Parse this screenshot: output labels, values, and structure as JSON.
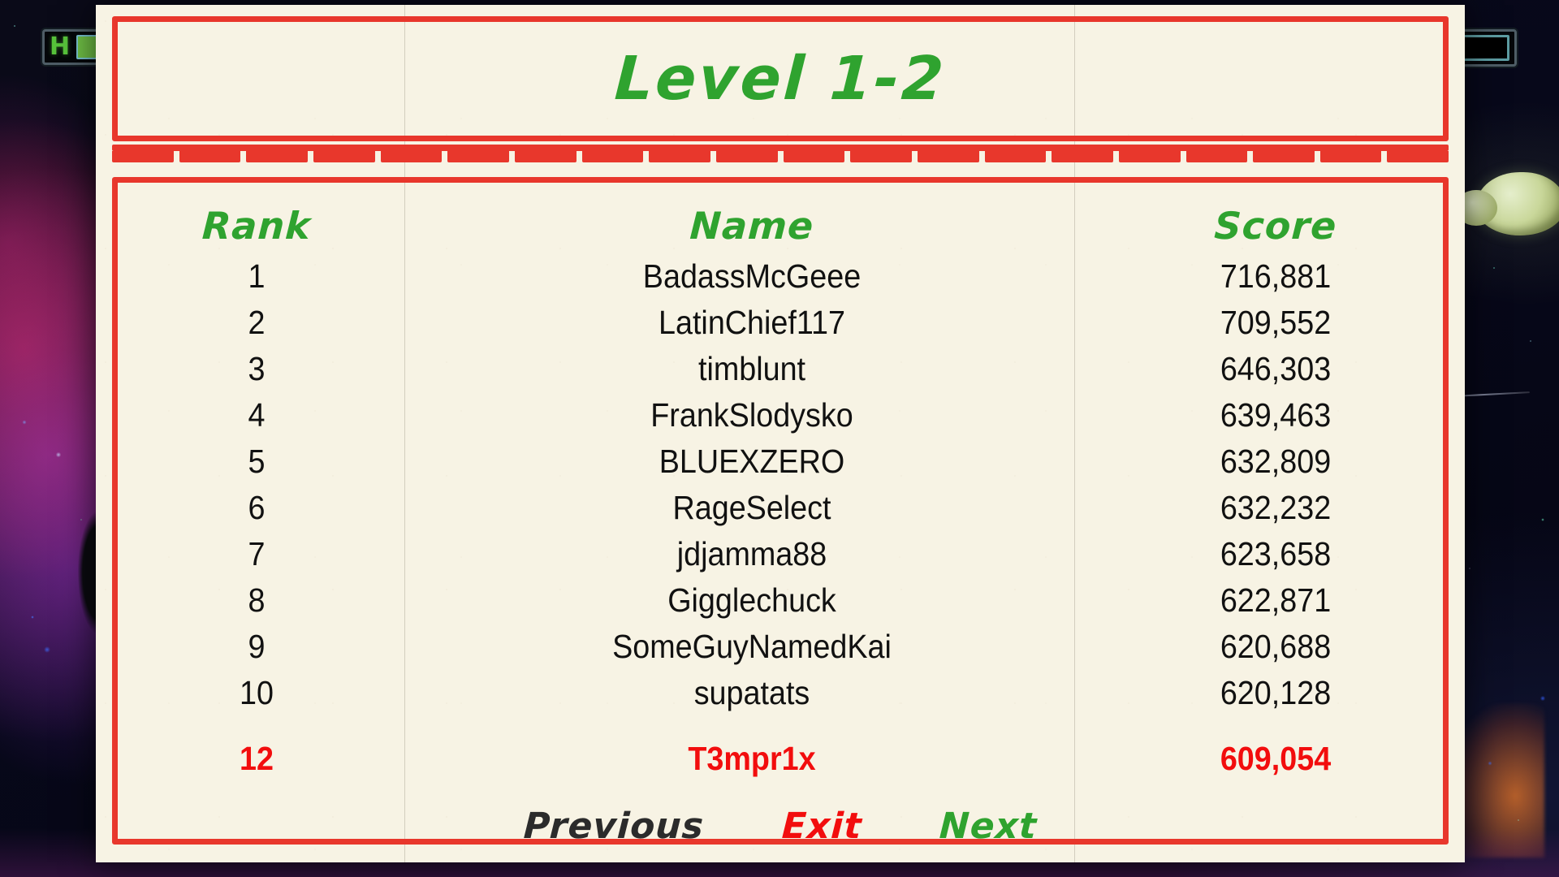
{
  "hud": {
    "health_letter": "H",
    "health_bar_label": "health-bar",
    "right_bar_label": "ammo-bar"
  },
  "panel": {
    "title": "Level 1-2"
  },
  "table": {
    "headers": {
      "rank": "Rank",
      "name": "Name",
      "score": "Score"
    },
    "rows": [
      {
        "rank": "1",
        "name": "BadassMcGeee",
        "score": "716,881"
      },
      {
        "rank": "2",
        "name": "LatinChief117",
        "score": "709,552"
      },
      {
        "rank": "3",
        "name": "timblunt",
        "score": "646,303"
      },
      {
        "rank": "4",
        "name": "FrankSlodysko",
        "score": "639,463"
      },
      {
        "rank": "5",
        "name": "BLUEXZERO",
        "score": "632,809"
      },
      {
        "rank": "6",
        "name": "RageSelect",
        "score": "632,232"
      },
      {
        "rank": "7",
        "name": "jdjamma88",
        "score": "623,658"
      },
      {
        "rank": "8",
        "name": "Gigglechuck",
        "score": "622,871"
      },
      {
        "rank": "9",
        "name": "SomeGuyNamedKai",
        "score": "620,688"
      },
      {
        "rank": "10",
        "name": "supatats",
        "score": "620,128"
      }
    ],
    "player_row": {
      "rank": "12",
      "name": "T3mpr1x",
      "score": "609,054"
    }
  },
  "nav": {
    "previous": "Previous",
    "exit": "Exit",
    "next": "Next"
  },
  "colors": {
    "border_red": "#e8372c",
    "title_green": "#2fa32f",
    "player_red": "#f20d0d",
    "paper": "#f7f3e4",
    "row_text": "#111111",
    "previous_text": "#2b2b2b"
  }
}
